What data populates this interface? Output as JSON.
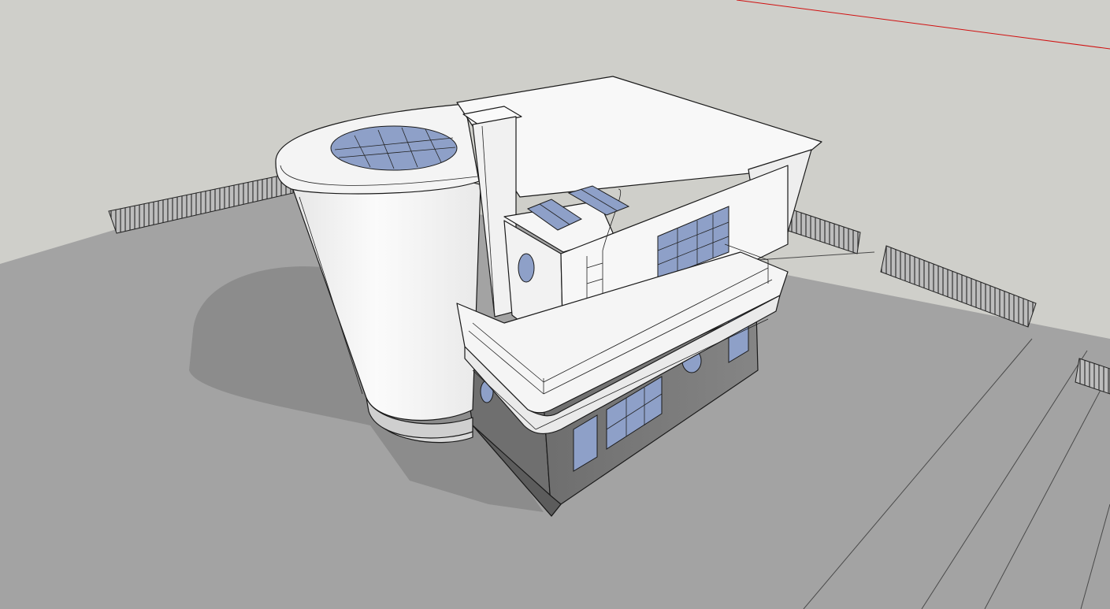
{
  "scene": {
    "type": "3d-model-viewport",
    "subject": "art-deco-house",
    "colors": {
      "sky": "#cfcfca",
      "ground": "#a3a3a3",
      "shadow": "#8f8f8f",
      "wall_light": "#f7f7f7",
      "wall_mid": "#e7e7e7",
      "wall_dark": "#7c7c7c",
      "glass": "#8ea0c8",
      "outline": "#1a1a1a",
      "axis_red": "#d01010"
    }
  }
}
